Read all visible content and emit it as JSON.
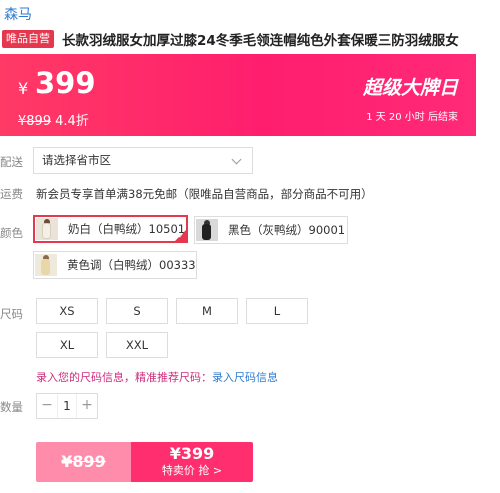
{
  "brand": "森马",
  "product": {
    "tag": "唯品自营",
    "title": "长款羽绒服女加厚过膝24冬季毛领连帽纯色外套保暖三防羽绒服女"
  },
  "banner": {
    "currency": "¥",
    "price": "399",
    "original_price": "¥899",
    "discount": "4.4折",
    "promo_title": "超级大牌日",
    "countdown": "1 天 20 小时 后结束"
  },
  "delivery": {
    "label": "配送",
    "placeholder": "请选择省市区"
  },
  "shipping": {
    "label": "运费",
    "text": "新会员专享首单满38元免邮（限唯品自营商品，部分商品不可用）"
  },
  "colors": {
    "label": "颜色",
    "options": [
      {
        "text": "奶白（白鸭绒）10501",
        "selected": true
      },
      {
        "text": "黑色（灰鸭绒）90001",
        "selected": false
      },
      {
        "text": "黄色调（白鸭绒）00333",
        "selected": false
      }
    ]
  },
  "sizes": {
    "label": "尺码",
    "options": [
      "XS",
      "S",
      "M",
      "L",
      "XL",
      "XXL"
    ]
  },
  "size_info": {
    "text": "录入您的尺码信息，精准推荐尺码：",
    "link": "录入尺码信息"
  },
  "quantity": {
    "label": "数量",
    "value": "1",
    "minus": "−",
    "plus": "+"
  },
  "buy": {
    "original_price": "¥899",
    "price": "¥399",
    "label": "特卖价 抢 >"
  },
  "theme": {
    "accent": "#ff1e6e",
    "brand_link": "#2e7ccf",
    "tag_bg": "#e5384f"
  }
}
